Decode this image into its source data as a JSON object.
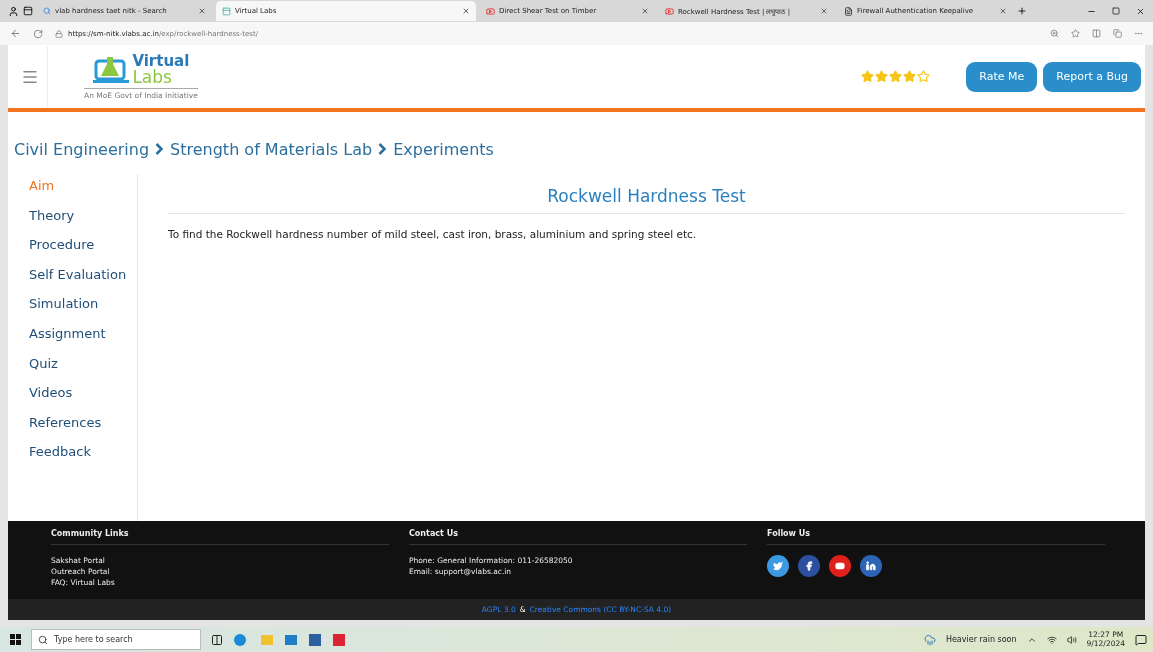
{
  "browser": {
    "tabs": [
      {
        "label": "vlab hardness taet nitk - Search",
        "kind": "search",
        "selected": false
      },
      {
        "label": "Virtual Labs",
        "kind": "site",
        "selected": true
      },
      {
        "label": "Direct Shear Test on Timber",
        "kind": "video",
        "selected": false
      },
      {
        "label": "Rockwell Hardness Test | लघुपाठ |",
        "kind": "video",
        "selected": false
      },
      {
        "label": "Firewall Authentication Keepalive",
        "kind": "page",
        "selected": false
      }
    ],
    "url_host": "https://sm-nitk.vlabs.ac.in",
    "url_path": "/exp/rockwell-hardness-test/"
  },
  "header": {
    "logo_top": "Virtual",
    "logo_bottom": "Labs",
    "logo_tagline": "An MoE Govt of India Initiative",
    "stars": 4,
    "buttons": [
      "Rate Me",
      "Report a Bug"
    ]
  },
  "breadcrumb": [
    "Civil Engineering",
    "Strength of Materials Lab",
    "Experiments"
  ],
  "sidebar": {
    "items": [
      {
        "label": "Aim",
        "selected": true
      },
      {
        "label": "Theory",
        "selected": false
      },
      {
        "label": "Procedure",
        "selected": false
      },
      {
        "label": "Self Evaluation",
        "selected": false
      },
      {
        "label": "Simulation",
        "selected": false
      },
      {
        "label": "Assignment",
        "selected": false
      },
      {
        "label": "Quiz",
        "selected": false
      },
      {
        "label": "Videos",
        "selected": false
      },
      {
        "label": "References",
        "selected": false
      },
      {
        "label": "Feedback",
        "selected": false
      }
    ]
  },
  "content": {
    "title": "Rockwell Hardness Test",
    "text": "To find the Rockwell hardness number of mild steel, cast iron, brass, aluminium and spring steel etc."
  },
  "footer": {
    "columns": [
      {
        "heading": "Community Links",
        "lines": [
          "Sakshat Portal",
          "Outreach Portal",
          "FAQ: Virtual Labs"
        ]
      },
      {
        "heading": "Contact Us",
        "lines": [
          "Phone: General Information: 011-26582050",
          "Email: support@vlabs.ac.in"
        ]
      },
      {
        "heading": "Follow Us",
        "socials": [
          {
            "kind": "twitter",
            "color": "#3b9ae1"
          },
          {
            "kind": "facebook",
            "color": "#2d4fa0"
          },
          {
            "kind": "youtube",
            "color": "#e0201b"
          },
          {
            "kind": "linkedin",
            "color": "#2c64b8"
          }
        ]
      }
    ],
    "license_a": "AGPL 3.0",
    "license_sep": "&",
    "license_b": "Creative Commons (CC BY-NC-SA 4.0)"
  },
  "taskbar": {
    "search_placeholder": "Type here to search",
    "weather": "Heavier rain soon",
    "time": "12:27 PM",
    "date": "9/12/2024"
  }
}
